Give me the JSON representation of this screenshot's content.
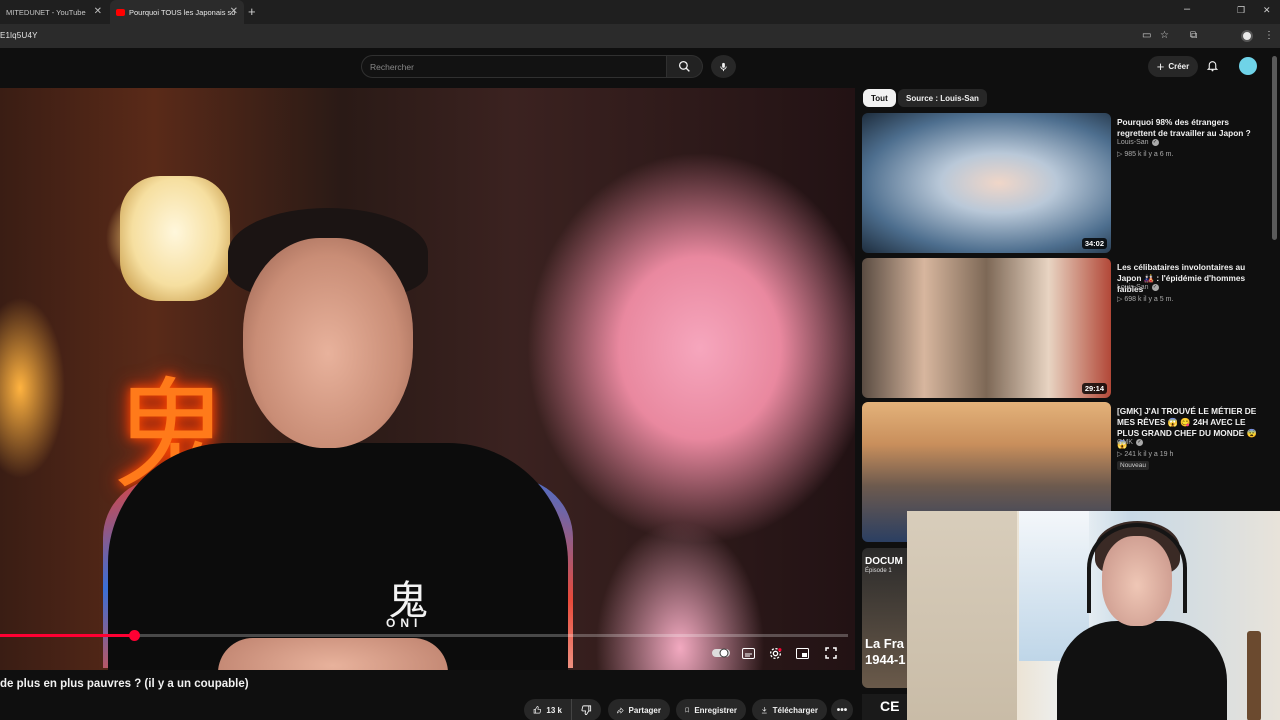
{
  "browser": {
    "tabs": [
      {
        "title": "MITEDUNET - YouTube",
        "active": false
      },
      {
        "title": "Pourquoi TOUS les Japonais so",
        "active": true
      }
    ],
    "url": "E1lq5U4Y"
  },
  "header": {
    "search_placeholder": "Rechercher",
    "create_label": "Créer"
  },
  "player": {
    "shirt_kanji": "鬼",
    "shirt_word": "ONI",
    "neon_sign": "鬼",
    "progress": 0.158
  },
  "video": {
    "title": "de plus en plus pauvres ? (il y a un coupable)",
    "like_count": "13 k",
    "share_label": "Partager",
    "save_label": "Enregistrer",
    "download_label": "Télécharger"
  },
  "sidebar": {
    "chips": [
      "Tout",
      "Source : Louis-San"
    ],
    "recommendations": [
      {
        "title": "Pourquoi 98% des étrangers regrettent de travailler au Japon ?",
        "channel": "Louis-San",
        "meta": "▷ 985 k   il y a 6 m.",
        "duration": "34:02"
      },
      {
        "title": "Les célibataires involontaires au Japon 🎎 : l'épidémie d'hommes faibles",
        "channel": "Louis-San",
        "meta": "▷ 698 k   il y a 5 m.",
        "duration": "29:14"
      },
      {
        "title": "[GMK] J'AI TROUVÉ LE MÉTIER DE MES RÊVES 😱 😋 24H AVEC LE PLUS GRAND CHEF DU MONDE 😨 😱",
        "channel": "GMK",
        "meta": "▷ 241 k   il y a 19 h",
        "badge": "Nouveau"
      }
    ],
    "partial_thumb": {
      "line1": "DOCUM",
      "line2": "Épisode 1",
      "line3": "La Fra\n1944-1"
    },
    "ce_thumb": "CE"
  },
  "colors": {
    "accent_red": "#ff0033",
    "background": "#0f0f0f",
    "pill": "#272727"
  }
}
